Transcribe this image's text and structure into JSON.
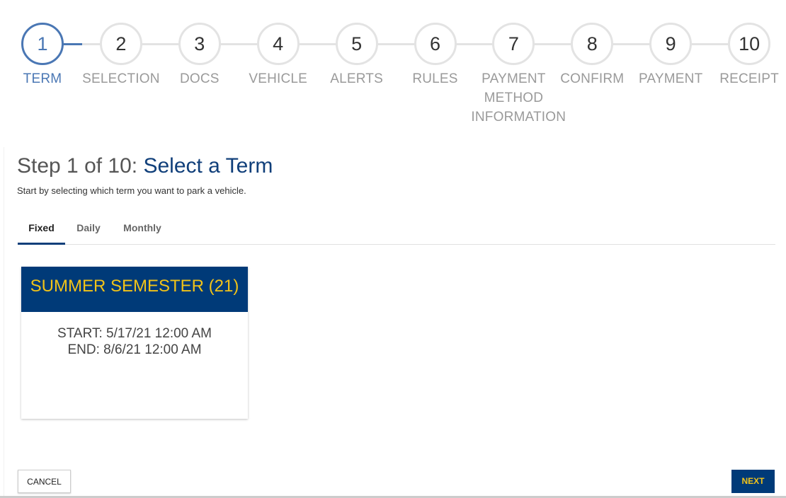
{
  "stepper": {
    "current": 1,
    "steps": [
      {
        "number": "1",
        "label": "TERM"
      },
      {
        "number": "2",
        "label": "SELECTION"
      },
      {
        "number": "3",
        "label": "DOCS"
      },
      {
        "number": "4",
        "label": "VEHICLE"
      },
      {
        "number": "5",
        "label": "ALERTS"
      },
      {
        "number": "6",
        "label": "RULES"
      },
      {
        "number": "7",
        "label": "PAYMENT METHOD INFORMATION"
      },
      {
        "number": "8",
        "label": "CONFIRM"
      },
      {
        "number": "9",
        "label": "PAYMENT"
      },
      {
        "number": "10",
        "label": "RECEIPT"
      }
    ]
  },
  "header": {
    "prefix": "Step 1 of 10: ",
    "title": "Select a Term",
    "subtitle": "Start by selecting which term you want to park a vehicle."
  },
  "tabs": [
    {
      "label": "Fixed",
      "active": true
    },
    {
      "label": "Daily"
    },
    {
      "label": "Monthly"
    }
  ],
  "term_card": {
    "title": "SUMMER SEMESTER (21)",
    "start": "START: 5/17/21 12:00 AM",
    "end": "END: 8/6/21 12:00 AM"
  },
  "footer": {
    "cancel_label": "CANCEL",
    "next_label": "NEXT"
  },
  "colors": {
    "primary": "#003a78",
    "accent": "#f2c318",
    "active_step": "#4a77b4"
  }
}
